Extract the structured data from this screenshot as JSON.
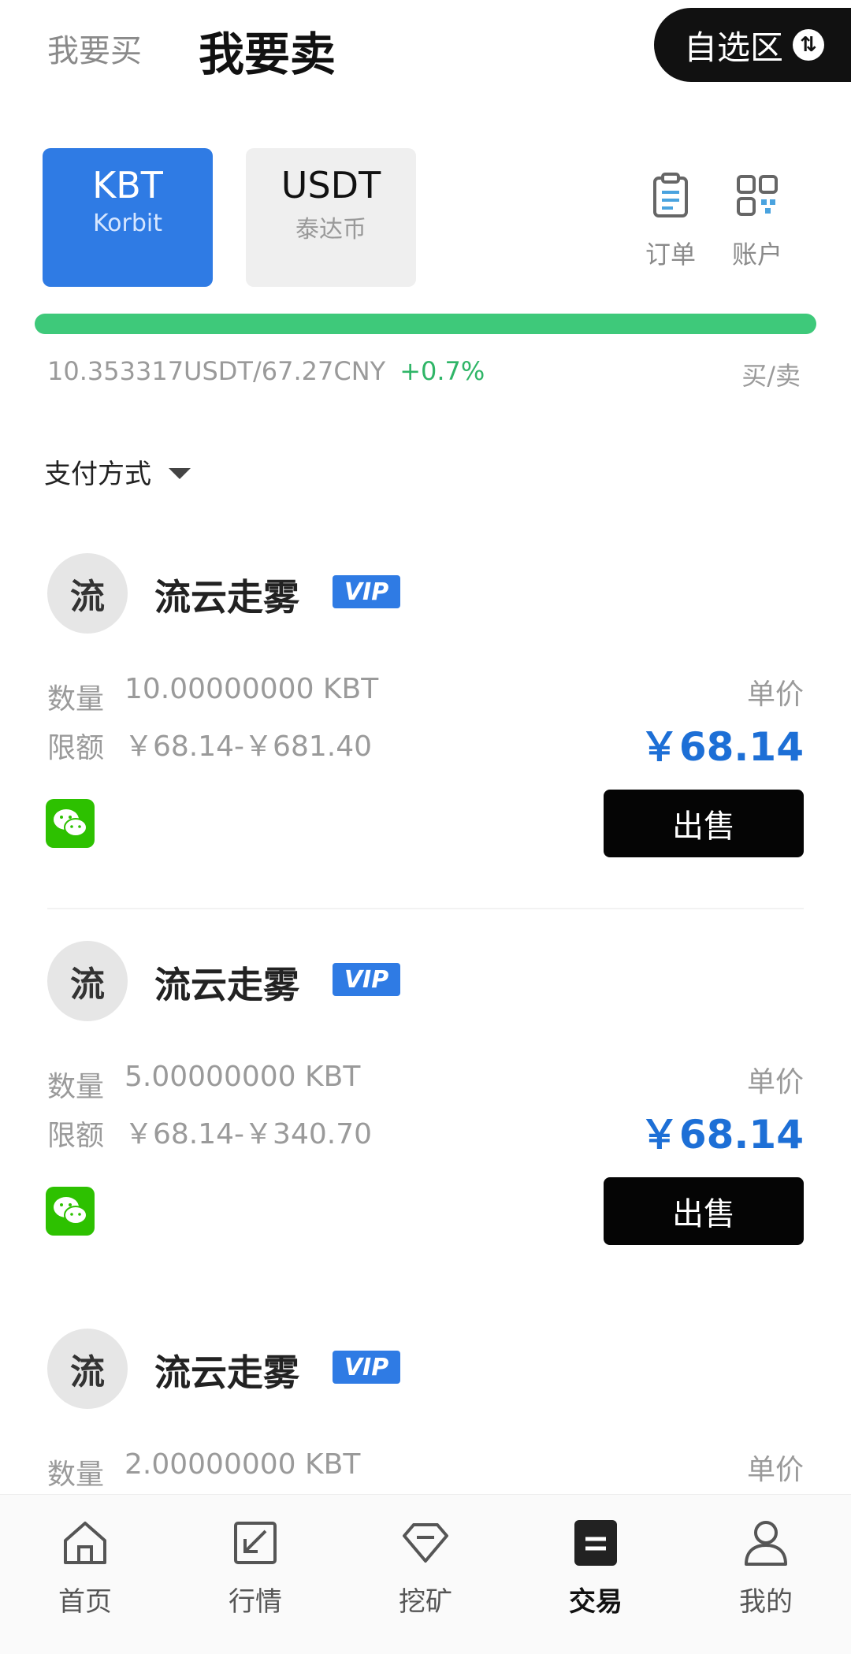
{
  "header": {
    "tab_buy": "我要买",
    "tab_sell": "我要卖",
    "watchlist_label": "自选区"
  },
  "coins": [
    {
      "symbol": "KBT",
      "name": "Korbit",
      "selected": true
    },
    {
      "symbol": "USDT",
      "name": "泰达币",
      "selected": false
    }
  ],
  "shortcuts": {
    "orders": "订单",
    "account": "账户"
  },
  "ticker": {
    "price": "10.353317USDT/67.27CNY",
    "change": "+0.7%",
    "link": "买/卖"
  },
  "filter": {
    "payment_method": "支付方式"
  },
  "labels": {
    "quantity": "数量",
    "limit": "限额",
    "unit_price": "单价",
    "sell": "出售",
    "vip": "VIP"
  },
  "listings": [
    {
      "avatar": "流",
      "seller": "流云走雾",
      "quantity": "10.00000000 KBT",
      "limit": "￥68.14-￥681.40",
      "price": "￥68.14",
      "payment": "wechat-icon"
    },
    {
      "avatar": "流",
      "seller": "流云走雾",
      "quantity": "5.00000000 KBT",
      "limit": "￥68.14-￥340.70",
      "price": "￥68.14",
      "payment": "wechat-icon"
    },
    {
      "avatar": "流",
      "seller": "流云走雾",
      "quantity": "2.00000000 KBT"
    }
  ],
  "nav": [
    {
      "label": "首页",
      "icon": "home-icon"
    },
    {
      "label": "行情",
      "icon": "market-icon"
    },
    {
      "label": "挖矿",
      "icon": "mining-icon"
    },
    {
      "label": "交易",
      "icon": "trade-icon",
      "active": true
    },
    {
      "label": "我的",
      "icon": "profile-icon"
    }
  ],
  "colors": {
    "accent": "#2f7be4",
    "progress": "#3ec97a",
    "price": "#1d6fd6",
    "wechat": "#2dc100"
  }
}
